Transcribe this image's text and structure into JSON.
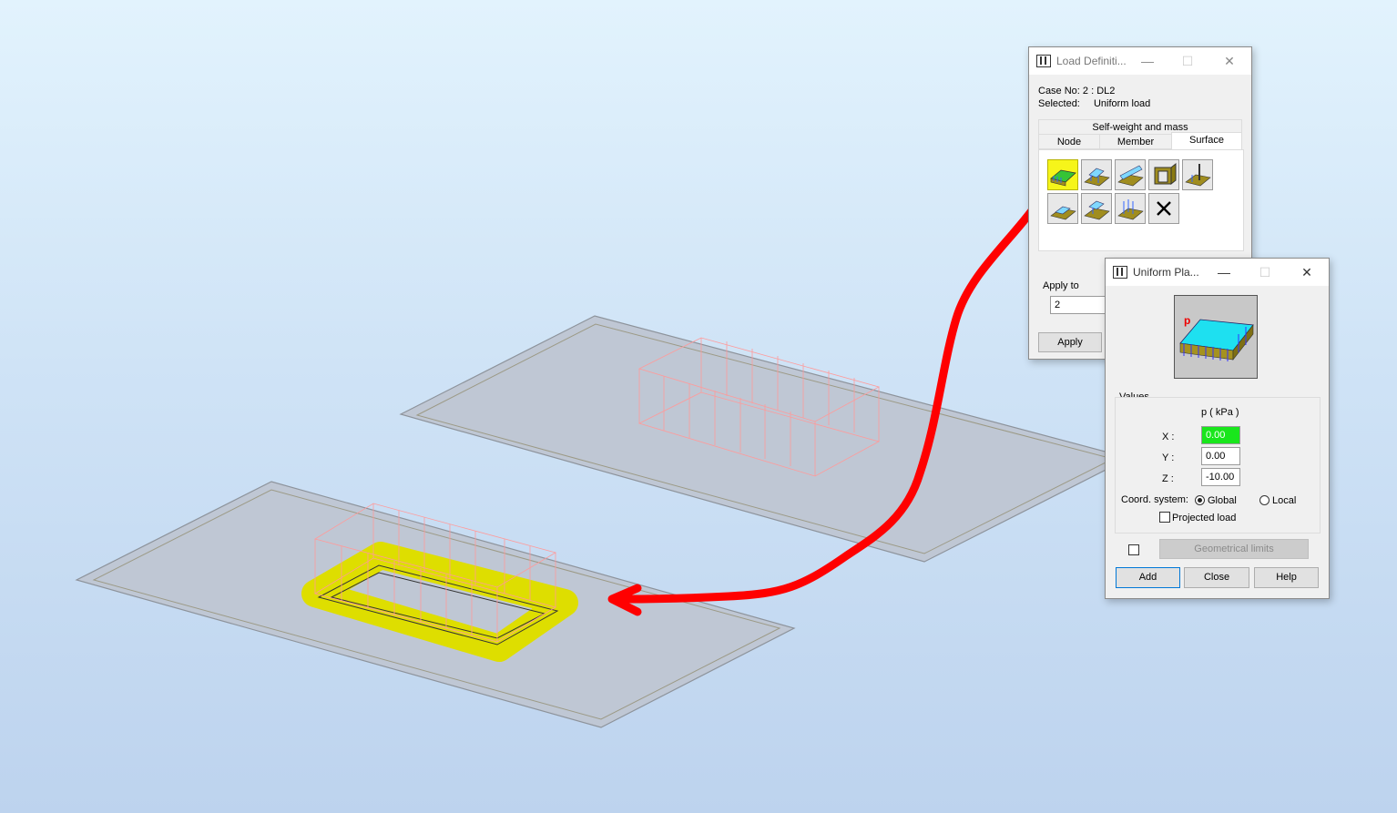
{
  "load_def": {
    "title": "Load Definiti...",
    "case_label": "Case No: 2 : DL2",
    "selected_label": "Selected:",
    "selected_value": "Uniform load",
    "tab_top": "Self-weight and mass",
    "tabs": [
      "Node",
      "Member",
      "Surface"
    ],
    "active_tab": "Surface",
    "apply_to_label": "Apply to",
    "apply_to_value": "2",
    "apply_button": "Apply"
  },
  "uniform": {
    "title": "Uniform Pla...",
    "values_label": "Values",
    "unit_header": "p  ( kPa )",
    "x_label": "X :",
    "x_value": "0.00",
    "y_label": "Y :",
    "y_value": "0.00",
    "z_label": "Z :",
    "z_value": "-10.00",
    "coord_label": "Coord. system:",
    "global_label": "Global",
    "local_label": "Local",
    "projected_label": "Projected load",
    "geom_button": "Geometrical limits",
    "add_button": "Add",
    "close_button": "Close",
    "help_button": "Help",
    "preview_letter": "p"
  },
  "colors": {
    "annotation_red": "#ff0000",
    "highlight_yellow": "#dede00",
    "load_lines": "#ff9a9a",
    "slab_fill": "#bfc7d4",
    "x_field_bg": "#19e61c"
  }
}
